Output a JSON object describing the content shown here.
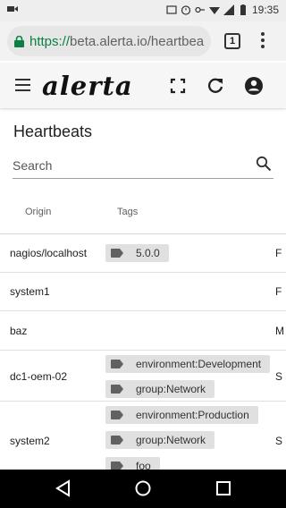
{
  "status_bar": {
    "time": "19:35"
  },
  "browser": {
    "url_scheme": "https://",
    "url_host": "beta.alerta.io/heartbea",
    "tab_count": "1"
  },
  "app": {
    "logo": "alerta"
  },
  "page": {
    "title": "Heartbeats",
    "search_placeholder": "Search"
  },
  "table": {
    "headers": {
      "origin": "Origin",
      "tags": "Tags"
    },
    "rows": [
      {
        "origin": "nagios/localhost",
        "tags": [
          "5.0.0"
        ],
        "extra": "F"
      },
      {
        "origin": "system1",
        "tags": [],
        "extra": "F"
      },
      {
        "origin": "baz",
        "tags": [],
        "extra": "M"
      },
      {
        "origin": "dc1-oem-02",
        "tags": [
          "environment:Development",
          "group:Network"
        ],
        "extra": "S"
      },
      {
        "origin": "system2",
        "tags": [
          "environment:Production",
          "group:Network",
          "foo"
        ],
        "extra": "S"
      }
    ]
  },
  "colors": {
    "url_green": "#0b8043",
    "chip_bg": "#e0e0e0",
    "toolbar_bg": "#f6f6f6"
  }
}
